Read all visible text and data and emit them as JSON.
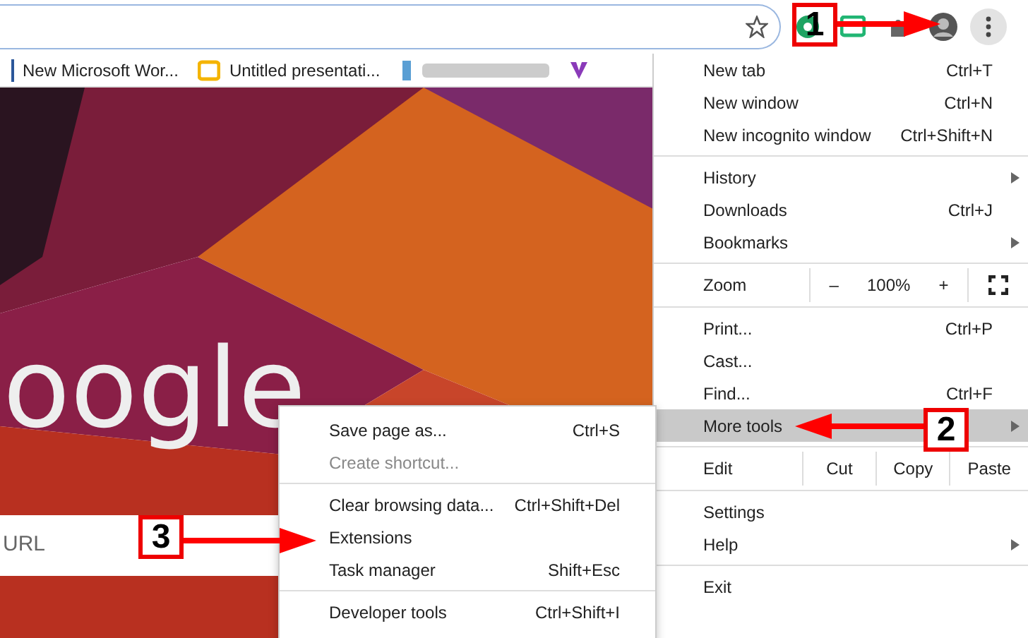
{
  "bookmarks": [
    {
      "kind": "doc",
      "label": "New Microsoft Wor..."
    },
    {
      "kind": "slides",
      "label": "Untitled presentati..."
    },
    {
      "kind": "blurred"
    },
    {
      "kind": "vpn"
    }
  ],
  "page": {
    "logo_text": "oogle",
    "search_placeholder": "URL"
  },
  "menu": {
    "sections": [
      [
        {
          "kind": "item",
          "label": "New tab",
          "shortcut": "Ctrl+T",
          "submenu": false,
          "highlighted": false
        },
        {
          "kind": "item",
          "label": "New window",
          "shortcut": "Ctrl+N",
          "submenu": false,
          "highlighted": false
        },
        {
          "kind": "item",
          "label": "New incognito window",
          "shortcut": "Ctrl+Shift+N",
          "submenu": false,
          "highlighted": false
        }
      ],
      [
        {
          "kind": "item",
          "label": "History",
          "submenu": true,
          "highlighted": false
        },
        {
          "kind": "item",
          "label": "Downloads",
          "shortcut": "Ctrl+J",
          "submenu": false,
          "highlighted": false
        },
        {
          "kind": "item",
          "label": "Bookmarks",
          "submenu": true,
          "highlighted": false
        }
      ],
      [
        {
          "kind": "zoom",
          "label": "Zoom",
          "minus": "–",
          "value": "100%",
          "plus": "+"
        }
      ],
      [
        {
          "kind": "item",
          "label": "Print...",
          "shortcut": "Ctrl+P",
          "submenu": false,
          "highlighted": false
        },
        {
          "kind": "item",
          "label": "Cast...",
          "submenu": false,
          "highlighted": false
        },
        {
          "kind": "item",
          "label": "Find...",
          "shortcut": "Ctrl+F",
          "submenu": false,
          "highlighted": false
        },
        {
          "kind": "item",
          "label": "More tools",
          "submenu": true,
          "highlighted": true
        }
      ],
      [
        {
          "kind": "edit",
          "label": "Edit",
          "buttons": [
            "Cut",
            "Copy",
            "Paste"
          ]
        }
      ],
      [
        {
          "kind": "item",
          "label": "Settings",
          "submenu": false,
          "highlighted": false
        },
        {
          "kind": "item",
          "label": "Help",
          "submenu": true,
          "highlighted": false
        }
      ],
      [
        {
          "kind": "item",
          "label": "Exit",
          "submenu": false,
          "highlighted": false
        }
      ]
    ]
  },
  "submenu": {
    "sections": [
      [
        {
          "label": "Save page as...",
          "shortcut": "Ctrl+S",
          "disabled": false
        },
        {
          "label": "Create shortcut...",
          "disabled": true
        }
      ],
      [
        {
          "label": "Clear browsing data...",
          "shortcut": "Ctrl+Shift+Del",
          "disabled": false
        },
        {
          "label": "Extensions",
          "disabled": false
        },
        {
          "label": "Task manager",
          "shortcut": "Shift+Esc",
          "disabled": false
        }
      ],
      [
        {
          "label": "Developer tools",
          "shortcut": "Ctrl+Shift+I",
          "disabled": false
        }
      ]
    ]
  },
  "annotations": [
    {
      "number": "1"
    },
    {
      "number": "2"
    },
    {
      "number": "3"
    }
  ]
}
